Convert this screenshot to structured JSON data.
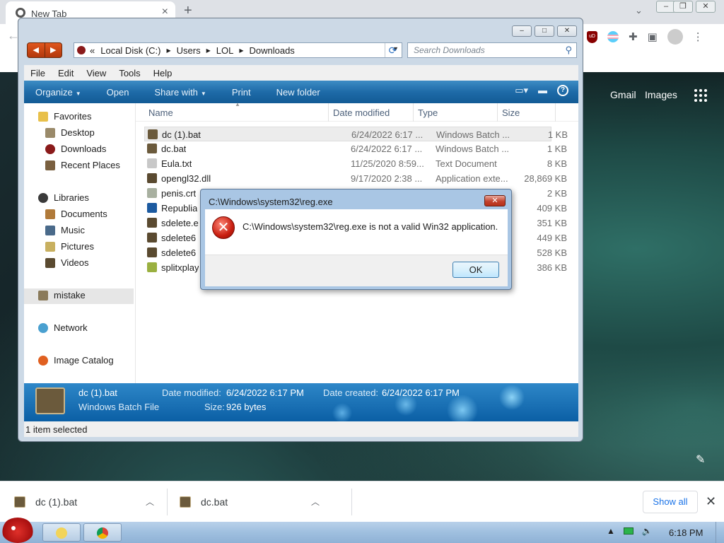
{
  "browser": {
    "tab_title": "New Tab",
    "newtab_links": {
      "gmail": "Gmail",
      "images": "Images"
    },
    "extension_ublock": "uD"
  },
  "explorer": {
    "breadcrumbs": [
      "Local Disk (C:)",
      "Users",
      "LOL",
      "Downloads"
    ],
    "breadcrumb_prefix": "«",
    "search_placeholder": "Search Downloads",
    "menu": [
      "File",
      "Edit",
      "View",
      "Tools",
      "Help"
    ],
    "toolbar": {
      "organize": "Organize",
      "open": "Open",
      "share_with": "Share with",
      "print": "Print",
      "new_folder": "New folder"
    },
    "nav": {
      "favorites": "Favorites",
      "desktop": "Desktop",
      "downloads": "Downloads",
      "recent_places": "Recent Places",
      "libraries": "Libraries",
      "documents": "Documents",
      "music": "Music",
      "pictures": "Pictures",
      "videos": "Videos",
      "mistake": "mistake",
      "network": "Network",
      "image_catalog": "Image Catalog"
    },
    "columns": {
      "name": "Name",
      "date": "Date modified",
      "type": "Type",
      "size": "Size"
    },
    "files": [
      {
        "name": "dc (1).bat",
        "date": "6/24/2022 6:17 ...",
        "type": "Windows Batch ...",
        "size": "1 KB"
      },
      {
        "name": "dc.bat",
        "date": "6/24/2022 6:17 ...",
        "type": "Windows Batch ...",
        "size": "1 KB"
      },
      {
        "name": "Eula.txt",
        "date": "11/25/2020 8:59...",
        "type": "Text Document",
        "size": "8 KB"
      },
      {
        "name": "opengl32.dll",
        "date": "9/17/2020 2:38 ...",
        "type": "Application exte...",
        "size": "28,869 KB"
      },
      {
        "name": "penis.crt",
        "date": "",
        "type": "",
        "size": "2 KB"
      },
      {
        "name": "Republia",
        "date": "",
        "type": "",
        "size": "409 KB"
      },
      {
        "name": "sdelete.e",
        "date": "",
        "type": "",
        "size": "351 KB"
      },
      {
        "name": "sdelete6",
        "date": "",
        "type": "",
        "size": "449 KB"
      },
      {
        "name": "sdelete6",
        "date": "",
        "type": "",
        "size": "528 KB"
      },
      {
        "name": "splitxplay",
        "date": "",
        "type": "",
        "size": "386 KB"
      }
    ],
    "details": {
      "name": "dc (1).bat",
      "type": "Windows Batch File",
      "date_modified_label": "Date modified:",
      "date_modified": "6/24/2022 6:17 PM",
      "date_created_label": "Date created:",
      "date_created": "6/24/2022 6:17 PM",
      "size_label": "Size:",
      "size": "926 bytes"
    },
    "status": "1 item selected"
  },
  "dialog": {
    "title": "C:\\Windows\\system32\\reg.exe",
    "message": "C:\\Windows\\system32\\reg.exe is not a valid Win32 application.",
    "ok": "OK"
  },
  "downloads": {
    "items": [
      "dc (1).bat",
      "dc.bat"
    ],
    "show_all": "Show all"
  },
  "taskbar": {
    "clock": "6:18 PM"
  },
  "colors": {
    "toolbar": "#1e6ba8",
    "chrome_link": "#1a73e8",
    "error_red": "#c81e10"
  }
}
